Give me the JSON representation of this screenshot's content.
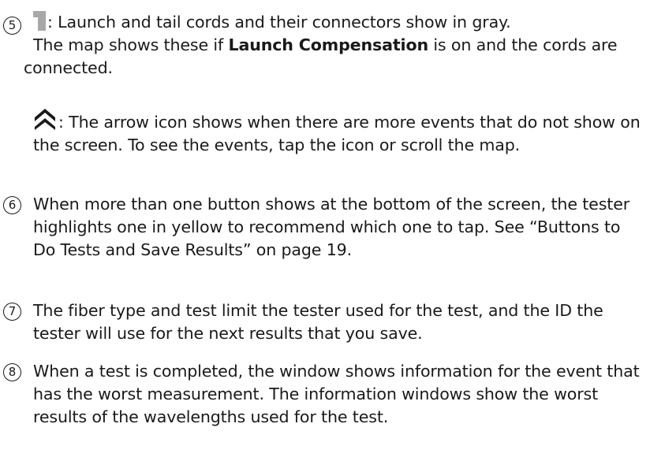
{
  "items": [
    {
      "number": "5",
      "part1": ": Launch and tail cords and their connectors show in gray.",
      "part2": "The map shows these if ",
      "bold": "Launch Compensation",
      "part3": " is on and the cords are connected.",
      "arrow_text": ": The arrow icon shows when there are more events that do not show on the screen. To see the events, tap the icon or scroll the map."
    },
    {
      "number": "6",
      "text": "When more than one button shows at the bottom of the screen, the tester highlights one in yellow to recommend which one to tap. See “Buttons to Do Tests and Save Results” on page 19."
    },
    {
      "number": "7",
      "text": "The fiber type and test limit the tester used for the test, and the ID the tester will use for the next results that you save."
    },
    {
      "number": "8",
      "text": "When a test is completed, the window shows information for the event that has the worst measurement. The information windows show the worst results of the wavelengths used for the test."
    }
  ],
  "icons": {
    "cord": "launch-cord-gray-icon",
    "arrow": "double-chevron-up-icon",
    "cord_color": "#a8a8a8",
    "arrow_color": "#1a1a1a"
  }
}
